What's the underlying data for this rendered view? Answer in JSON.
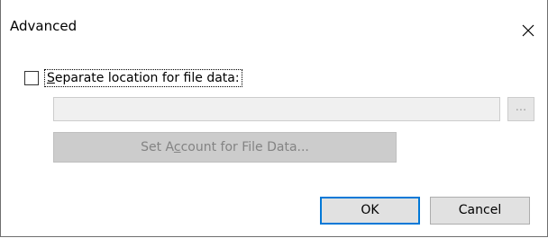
{
  "dialog": {
    "title": "Advanced",
    "close_label": "Close"
  },
  "file_data": {
    "checkbox_checked": false,
    "checkbox_label": "Separate location for file data:",
    "checkbox_label_access_key": "S",
    "path_value": "",
    "path_enabled": false,
    "browse_label": "...",
    "browse_enabled": false,
    "set_account_label_pre": "Set A",
    "set_account_label_key": "c",
    "set_account_label_post": "count for File Data...",
    "set_account_enabled": false
  },
  "buttons": {
    "ok_label": "OK",
    "cancel_label": "Cancel"
  },
  "colors": {
    "focus_border": "#0078d7",
    "button_face": "#e1e1e1",
    "disabled_button_face": "#cccccc",
    "disabled_text": "#838383"
  },
  "icons": {
    "close": "close-icon"
  }
}
